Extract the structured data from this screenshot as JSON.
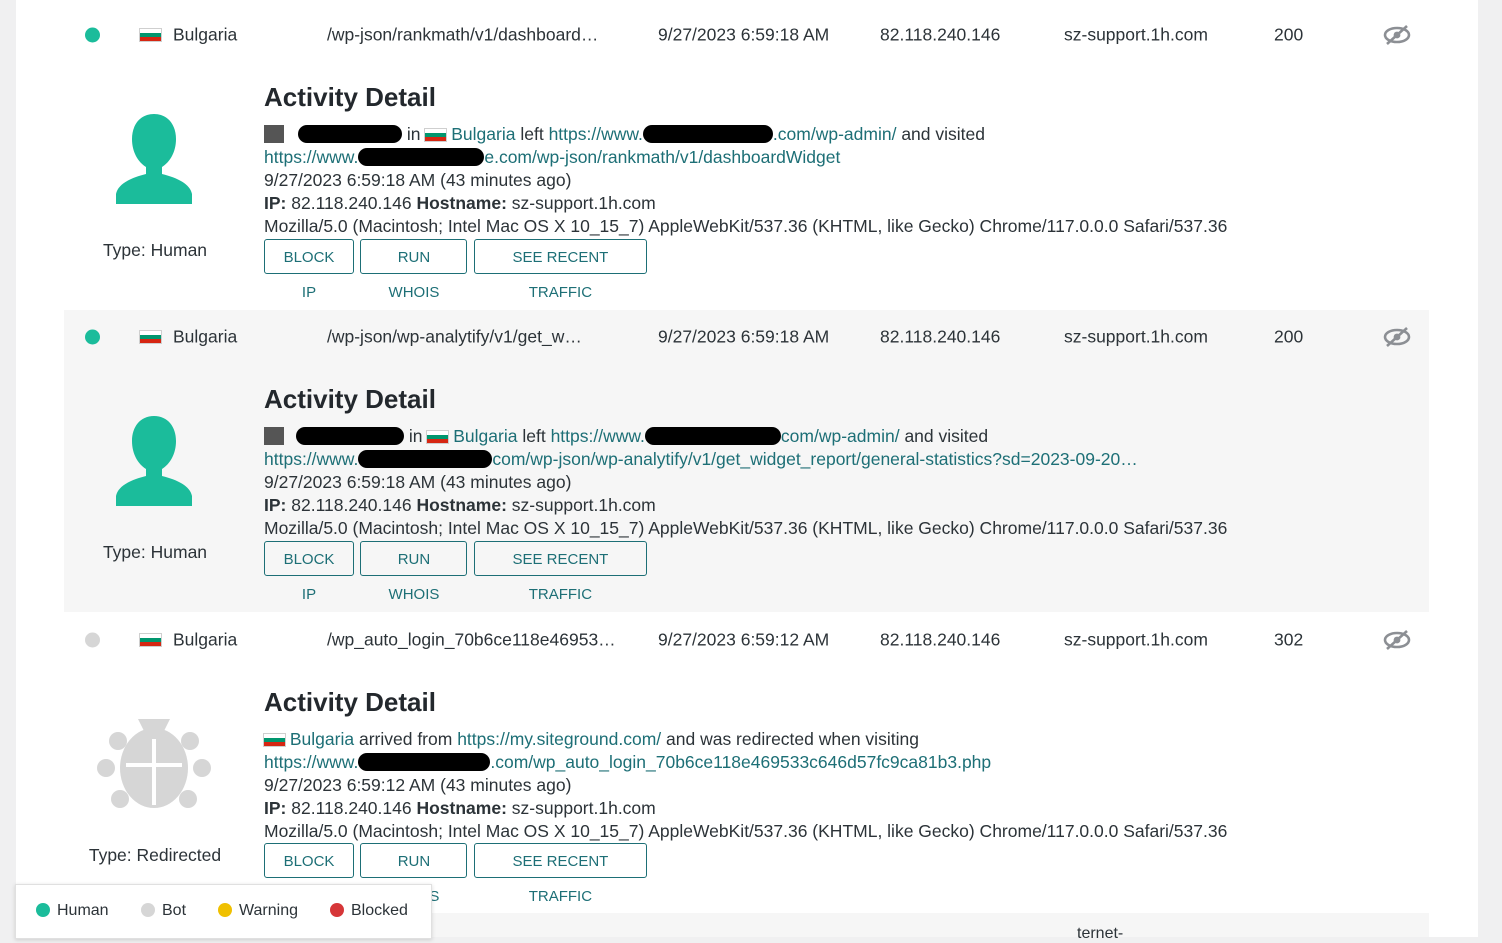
{
  "colors": {
    "human": "#1bbc9b",
    "bot": "#d6d6d6",
    "warning": "#f0c000",
    "blocked": "#d63638",
    "link": "#1d6f76"
  },
  "entries": [
    {
      "status": "human",
      "country": "Bulgaria",
      "path": "/wp-json/rankmath/v1/dashboard…",
      "time": "9/27/2023 6:59:18 AM",
      "ip": "82.118.240.146",
      "host": "sz-support.1h.com",
      "code": "200",
      "detail": {
        "title": "Activity Detail",
        "in_word": "in",
        "country": "Bulgaria",
        "left_word": "left",
        "referrer_prefix": "https://www.",
        "referrer_suffix": ".com/wp-admin/",
        "visited_word": "and visited",
        "url_prefix": "https://www.",
        "url_suffix": "e.com/wp-json/rankmath/v1/dashboardWidget",
        "time_line": "9/27/2023 6:59:18 AM (43 minutes ago)",
        "ip_label": "IP:",
        "ip": "82.118.240.146",
        "host_label": "Hostname:",
        "host": "sz-support.1h.com",
        "ua": "Mozilla/5.0 (Macintosh; Intel Mac OS X 10_15_7) AppleWebKit/537.36 (KHTML, like Gecko) Chrome/117.0.0.0 Safari/537.36",
        "type": "Type: Human",
        "buttons": [
          "BLOCK IP",
          "RUN WHOIS",
          "SEE RECENT TRAFFIC"
        ]
      }
    },
    {
      "status": "human",
      "country": "Bulgaria",
      "path": "/wp-json/wp-analytify/v1/get_w…",
      "time": "9/27/2023 6:59:18 AM",
      "ip": "82.118.240.146",
      "host": "sz-support.1h.com",
      "code": "200",
      "detail": {
        "title": "Activity Detail",
        "in_word": "in",
        "country": "Bulgaria",
        "left_word": "left",
        "referrer_prefix": "https://www.",
        "referrer_suffix": "com/wp-admin/",
        "visited_word": "and visited",
        "url_prefix": "https://www.",
        "url_suffix": "com/wp-json/wp-analytify/v1/get_widget_report/general-statistics?sd=2023-09-20…",
        "time_line": "9/27/2023 6:59:18 AM (43 minutes ago)",
        "ip_label": "IP:",
        "ip": "82.118.240.146",
        "host_label": "Hostname:",
        "host": "sz-support.1h.com",
        "ua": "Mozilla/5.0 (Macintosh; Intel Mac OS X 10_15_7) AppleWebKit/537.36 (KHTML, like Gecko) Chrome/117.0.0.0 Safari/537.36",
        "type": "Type: Human",
        "buttons": [
          "BLOCK IP",
          "RUN WHOIS",
          "SEE RECENT TRAFFIC"
        ]
      }
    },
    {
      "status": "bot",
      "country": "Bulgaria",
      "path": "/wp_auto_login_70b6ce118e46953…",
      "time": "9/27/2023 6:59:12 AM",
      "ip": "82.118.240.146",
      "host": "sz-support.1h.com",
      "code": "302",
      "detail": {
        "title": "Activity Detail",
        "country": "Bulgaria",
        "arrived_word": "arrived from",
        "referrer": "https://my.siteground.com/",
        "redirect_word": "and was redirected when visiting",
        "url_prefix": "https://www.",
        "url_suffix": ".com/wp_auto_login_70b6ce118e469533c646d57fc9ca81b3.php",
        "time_line": "9/27/2023 6:59:12 AM (43 minutes ago)",
        "ip_label": "IP:",
        "ip": "82.118.240.146",
        "host_label": "Hostname:",
        "host": "sz-support.1h.com",
        "ua": "Mozilla/5.0 (Macintosh; Intel Mac OS X 10_15_7) AppleWebKit/537.36 (KHTML, like Gecko) Chrome/117.0.0.0 Safari/537.36",
        "type": "Type: Redirected",
        "buttons": [
          "BLOCK IP",
          "RUN WHOIS",
          "SEE RECENT TRAFFIC"
        ]
      }
    }
  ],
  "next_row_text": "ternet-",
  "legend": [
    "Human",
    "Bot",
    "Warning",
    "Blocked"
  ]
}
